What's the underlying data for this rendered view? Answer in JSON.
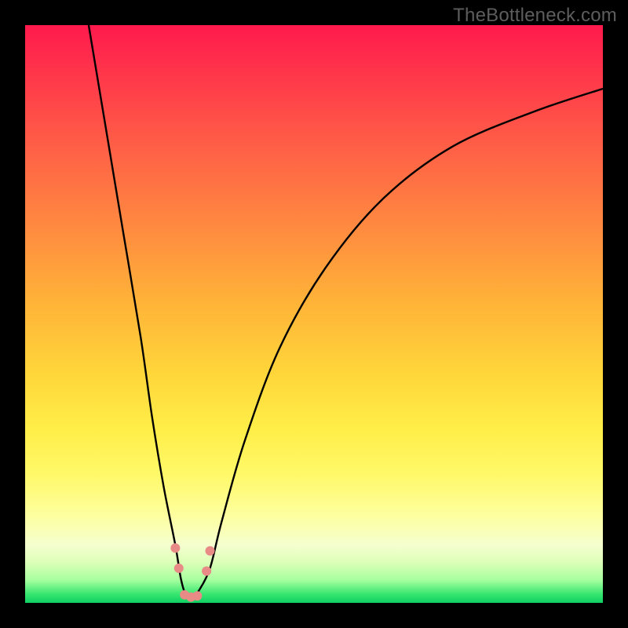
{
  "watermark": "TheBottleneck.com",
  "chart_data": {
    "type": "line",
    "title": "",
    "xlabel": "",
    "ylabel": "",
    "xlim": [
      0,
      100
    ],
    "ylim": [
      0,
      100
    ],
    "grid": false,
    "series": [
      {
        "name": "bottleneck-curve",
        "x": [
          11,
          14,
          17,
          20,
          22,
          24,
          26,
          27,
          28,
          29,
          30,
          32,
          34,
          38,
          44,
          52,
          62,
          74,
          88,
          100
        ],
        "values": [
          100,
          82,
          64,
          46,
          32,
          20,
          10,
          4,
          1,
          1,
          2,
          6,
          14,
          28,
          44,
          58,
          70,
          79,
          85,
          89
        ]
      }
    ],
    "markers": [
      {
        "name": "left-cluster-upper",
        "x": 26.0,
        "y": 9.5,
        "color": "#e88a86",
        "r": 6
      },
      {
        "name": "left-cluster-lower",
        "x": 26.6,
        "y": 6.0,
        "color": "#e88a86",
        "r": 6
      },
      {
        "name": "right-cluster-upper",
        "x": 32.0,
        "y": 9.0,
        "color": "#e88a86",
        "r": 6
      },
      {
        "name": "right-cluster-lower",
        "x": 31.4,
        "y": 5.5,
        "color": "#e88a86",
        "r": 6
      },
      {
        "name": "bottom-1",
        "x": 27.6,
        "y": 1.4,
        "color": "#e88a86",
        "r": 6
      },
      {
        "name": "bottom-2",
        "x": 28.7,
        "y": 1.0,
        "color": "#e88a86",
        "r": 6
      },
      {
        "name": "bottom-3",
        "x": 29.8,
        "y": 1.2,
        "color": "#e88a86",
        "r": 6
      }
    ]
  }
}
